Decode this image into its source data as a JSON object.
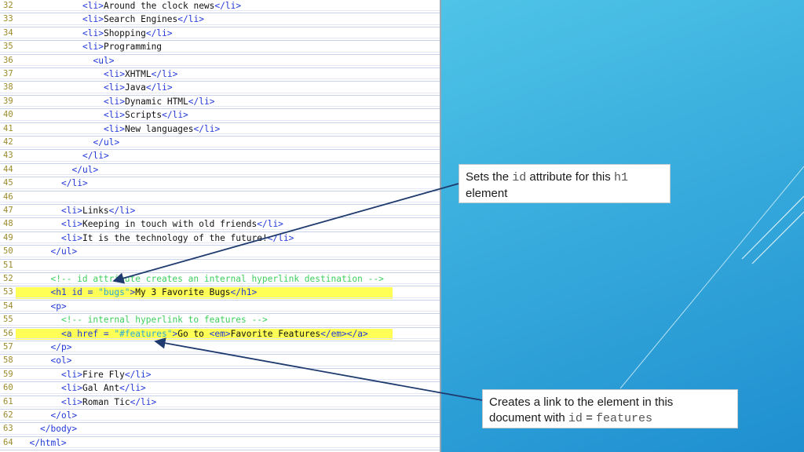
{
  "code_lines": [
    {
      "n": "32",
      "indent": 12,
      "parts": [
        {
          "t": "tag",
          "v": "<li>"
        },
        {
          "t": "txt",
          "v": "Around the clock news"
        },
        {
          "t": "tag",
          "v": "</li>"
        }
      ]
    },
    {
      "n": "33",
      "indent": 12,
      "parts": [
        {
          "t": "tag",
          "v": "<li>"
        },
        {
          "t": "txt",
          "v": "Search Engines"
        },
        {
          "t": "tag",
          "v": "</li>"
        }
      ]
    },
    {
      "n": "34",
      "indent": 12,
      "parts": [
        {
          "t": "tag",
          "v": "<li>"
        },
        {
          "t": "txt",
          "v": "Shopping"
        },
        {
          "t": "tag",
          "v": "</li>"
        }
      ]
    },
    {
      "n": "35",
      "indent": 12,
      "parts": [
        {
          "t": "tag",
          "v": "<li>"
        },
        {
          "t": "txt",
          "v": "Programming"
        }
      ]
    },
    {
      "n": "36",
      "indent": 14,
      "parts": [
        {
          "t": "tag",
          "v": "<ul>"
        }
      ]
    },
    {
      "n": "37",
      "indent": 16,
      "parts": [
        {
          "t": "tag",
          "v": "<li>"
        },
        {
          "t": "txt",
          "v": "XHTML"
        },
        {
          "t": "tag",
          "v": "</li>"
        }
      ]
    },
    {
      "n": "38",
      "indent": 16,
      "parts": [
        {
          "t": "tag",
          "v": "<li>"
        },
        {
          "t": "txt",
          "v": "Java"
        },
        {
          "t": "tag",
          "v": "</li>"
        }
      ]
    },
    {
      "n": "39",
      "indent": 16,
      "parts": [
        {
          "t": "tag",
          "v": "<li>"
        },
        {
          "t": "txt",
          "v": "Dynamic HTML"
        },
        {
          "t": "tag",
          "v": "</li>"
        }
      ]
    },
    {
      "n": "40",
      "indent": 16,
      "parts": [
        {
          "t": "tag",
          "v": "<li>"
        },
        {
          "t": "txt",
          "v": "Scripts"
        },
        {
          "t": "tag",
          "v": "</li>"
        }
      ]
    },
    {
      "n": "41",
      "indent": 16,
      "parts": [
        {
          "t": "tag",
          "v": "<li>"
        },
        {
          "t": "txt",
          "v": "New languages"
        },
        {
          "t": "tag",
          "v": "</li>"
        }
      ]
    },
    {
      "n": "42",
      "indent": 14,
      "parts": [
        {
          "t": "tag",
          "v": "</ul>"
        }
      ]
    },
    {
      "n": "43",
      "indent": 12,
      "parts": [
        {
          "t": "tag",
          "v": "</li>"
        }
      ]
    },
    {
      "n": "44",
      "indent": 10,
      "parts": [
        {
          "t": "tag",
          "v": "</ul>"
        }
      ]
    },
    {
      "n": "45",
      "indent": 8,
      "parts": [
        {
          "t": "tag",
          "v": "</li>"
        }
      ]
    },
    {
      "n": "46",
      "indent": 0,
      "parts": []
    },
    {
      "n": "47",
      "indent": 8,
      "parts": [
        {
          "t": "tag",
          "v": "<li>"
        },
        {
          "t": "txt",
          "v": "Links"
        },
        {
          "t": "tag",
          "v": "</li>"
        }
      ]
    },
    {
      "n": "48",
      "indent": 8,
      "parts": [
        {
          "t": "tag",
          "v": "<li>"
        },
        {
          "t": "txt",
          "v": "Keeping in touch with old friends"
        },
        {
          "t": "tag",
          "v": "</li>"
        }
      ]
    },
    {
      "n": "49",
      "indent": 8,
      "parts": [
        {
          "t": "tag",
          "v": "<li>"
        },
        {
          "t": "txt",
          "v": "It is the technology of the future!"
        },
        {
          "t": "tag",
          "v": "</li>"
        }
      ]
    },
    {
      "n": "50",
      "indent": 6,
      "parts": [
        {
          "t": "tag",
          "v": "</ul>"
        }
      ]
    },
    {
      "n": "51",
      "indent": 0,
      "parts": []
    },
    {
      "n": "52",
      "indent": 6,
      "parts": [
        {
          "t": "cmt",
          "v": "<!-- id attribute creates an internal hyperlink destination -->"
        }
      ]
    },
    {
      "n": "53",
      "indent": 6,
      "hl": true,
      "parts": [
        {
          "t": "tag",
          "v": "<h1 id = "
        },
        {
          "t": "str",
          "v": "\"bugs\""
        },
        {
          "t": "tag",
          "v": ">"
        },
        {
          "t": "txt",
          "v": "My 3 Favorite Bugs"
        },
        {
          "t": "tag",
          "v": "</h1>"
        }
      ]
    },
    {
      "n": "54",
      "indent": 6,
      "parts": [
        {
          "t": "tag",
          "v": "<p>"
        }
      ]
    },
    {
      "n": "55",
      "indent": 8,
      "parts": [
        {
          "t": "cmt",
          "v": "<!-- internal hyperlink to features -->"
        }
      ]
    },
    {
      "n": "56",
      "indent": 8,
      "hl": true,
      "parts": [
        {
          "t": "tag",
          "v": "<a href = "
        },
        {
          "t": "str",
          "v": "\"#features\""
        },
        {
          "t": "tag",
          "v": ">"
        },
        {
          "t": "txt",
          "v": "Go to "
        },
        {
          "t": "tag",
          "v": "<em>"
        },
        {
          "t": "txt",
          "v": "Favorite Features"
        },
        {
          "t": "tag",
          "v": "</em></a>"
        }
      ]
    },
    {
      "n": "57",
      "indent": 6,
      "parts": [
        {
          "t": "tag",
          "v": "</p>"
        }
      ]
    },
    {
      "n": "58",
      "indent": 6,
      "parts": [
        {
          "t": "tag",
          "v": "<ol>"
        }
      ]
    },
    {
      "n": "59",
      "indent": 8,
      "parts": [
        {
          "t": "tag",
          "v": "<li>"
        },
        {
          "t": "txt",
          "v": "Fire Fly"
        },
        {
          "t": "tag",
          "v": "</li>"
        }
      ]
    },
    {
      "n": "60",
      "indent": 8,
      "parts": [
        {
          "t": "tag",
          "v": "<li>"
        },
        {
          "t": "txt",
          "v": "Gal Ant"
        },
        {
          "t": "tag",
          "v": "</li>"
        }
      ]
    },
    {
      "n": "61",
      "indent": 8,
      "parts": [
        {
          "t": "tag",
          "v": "<li>"
        },
        {
          "t": "txt",
          "v": "Roman Tic"
        },
        {
          "t": "tag",
          "v": "</li>"
        }
      ]
    },
    {
      "n": "62",
      "indent": 6,
      "parts": [
        {
          "t": "tag",
          "v": "</ol>"
        }
      ]
    },
    {
      "n": "63",
      "indent": 4,
      "parts": [
        {
          "t": "tag",
          "v": "</body>"
        }
      ]
    },
    {
      "n": "64",
      "indent": 2,
      "parts": [
        {
          "t": "tag",
          "v": "</html>"
        }
      ]
    }
  ],
  "callouts": {
    "id_attr": {
      "pre": "Sets the ",
      "code1": "id",
      "mid": " attribute for this ",
      "code2": "h1",
      "post": "element"
    },
    "link": {
      "line1": "Creates a link to the element  in this",
      "pre": "document with ",
      "code1": "id",
      "mid": " = ",
      "code2": "features"
    }
  },
  "colors": {
    "tag": "#2238d8",
    "comment": "#3fcf5f",
    "string": "#2aa9d8",
    "highlight": "#ffff55",
    "arrow": "#1f3a6e"
  }
}
